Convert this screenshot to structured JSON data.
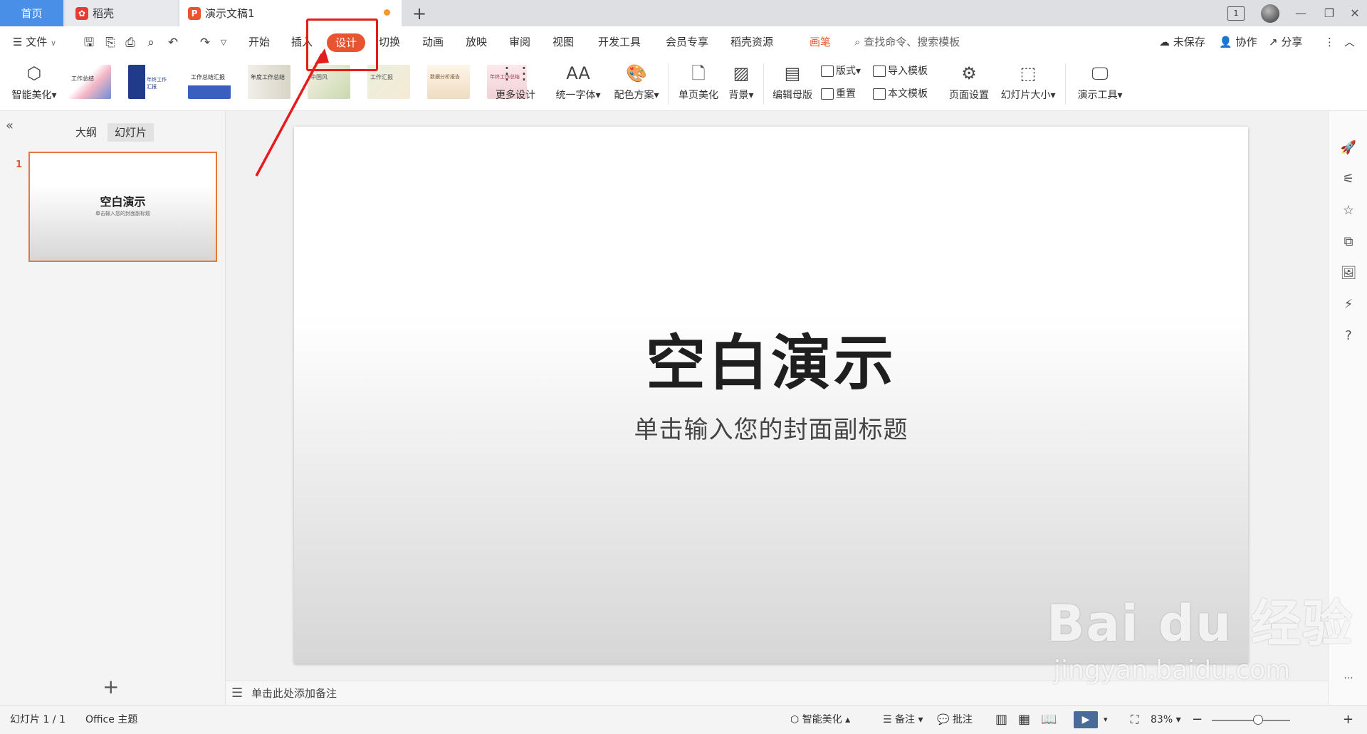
{
  "titlebar": {
    "tabs": [
      {
        "label": "首页"
      },
      {
        "label": "稻壳"
      },
      {
        "label": "演示文稿1"
      }
    ],
    "page_badge": "1"
  },
  "menu": {
    "file": "文件",
    "items": [
      "开始",
      "插入",
      "设计",
      "切换",
      "动画",
      "放映",
      "审阅",
      "视图",
      "开发工具",
      "会员专享",
      "稻壳资源"
    ],
    "pen": "画笔",
    "search_placeholder": "查找命令、搜索模板",
    "unsaved": "未保存",
    "collab": "协作",
    "share": "分享"
  },
  "ribbon": {
    "smart_beautify": "智能美化",
    "templates": [
      "工作总结",
      "年终工作汇报",
      "工作总结汇报",
      "年度工作总结",
      "中国风",
      "工作汇报",
      "数据分析报告",
      "年终工作总结"
    ],
    "more_design": "更多设计",
    "unify_font": "统一字体",
    "color_scheme": "配色方案",
    "single_page": "单页美化",
    "background": "背景",
    "edit_master": "编辑母版",
    "layout": "版式",
    "reset": "重置",
    "import_template": "导入模板",
    "this_template": "本文模板",
    "page_setup": "页面设置",
    "slide_size": "幻灯片大小",
    "present_tools": "演示工具"
  },
  "leftpanel": {
    "tab_outline": "大纲",
    "tab_slides": "幻灯片",
    "slide_number": "1",
    "thumb_title": "空白演示",
    "thumb_subtitle": "单击输入您的封面副标题"
  },
  "slide": {
    "title": "空白演示",
    "subtitle": "单击输入您的封面副标题"
  },
  "notes": {
    "placeholder": "单击此处添加备注"
  },
  "statusbar": {
    "slide_info": "幻灯片 1 / 1",
    "theme": "Office 主题",
    "smart_beautify": "智能美化",
    "notes": "备注",
    "comments": "批注",
    "zoom": "83%"
  },
  "watermark": {
    "main": "Bai du 经验",
    "sub": "jingyan.baidu.com"
  },
  "colors": {
    "accent": "#e8542f",
    "home_tab": "#4a8fe7",
    "annotation": "#e51c1c"
  }
}
